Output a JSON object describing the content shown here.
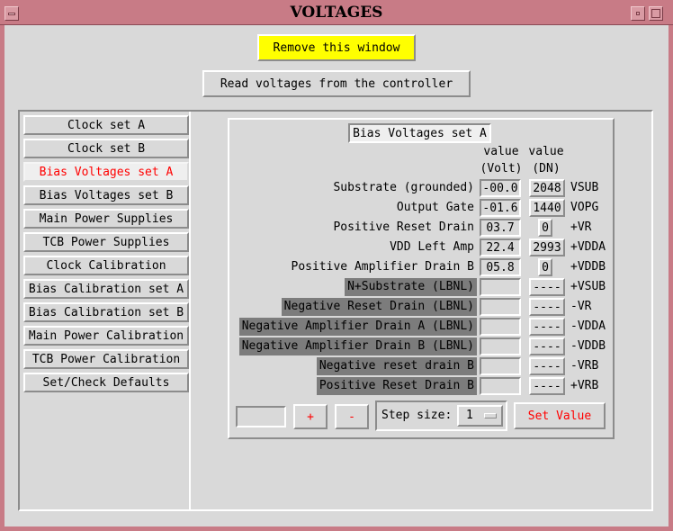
{
  "window": {
    "title": "VOLTAGES"
  },
  "buttons": {
    "remove_window": "Remove this window",
    "read_voltages": "Read voltages from the controller"
  },
  "nav": {
    "selected_index": 2,
    "items": [
      {
        "label": "Clock set A"
      },
      {
        "label": "Clock set B"
      },
      {
        "label": "Bias Voltages set A"
      },
      {
        "label": "Bias Voltages set B"
      },
      {
        "label": "Main Power Supplies"
      },
      {
        "label": "TCB Power Supplies"
      },
      {
        "label": "Clock Calibration"
      },
      {
        "label": "Bias Calibration set A"
      },
      {
        "label": "Bias Calibration set B"
      },
      {
        "label": "Main Power Calibration"
      },
      {
        "label": "TCB Power Calibration"
      },
      {
        "label": "Set/Check Defaults"
      }
    ]
  },
  "panel": {
    "header": "Bias Voltages set A",
    "col_value_volt": [
      "value",
      "(Volt)"
    ],
    "col_value_dn": [
      "value",
      "(DN)"
    ],
    "rows": [
      {
        "label": "Substrate  (grounded)",
        "volt": "-00.0",
        "dn": "2048",
        "signal": "VSUB",
        "dark": false
      },
      {
        "label": "Output Gate",
        "volt": "-01.6",
        "dn": "1440",
        "signal": "VOPG",
        "dark": false
      },
      {
        "label": "Positive Reset Drain",
        "volt": "03.7",
        "dn": "0",
        "signal": "+VR",
        "dark": false
      },
      {
        "label": "VDD Left Amp",
        "volt": "22.4",
        "dn": "2993",
        "signal": "+VDDA",
        "dark": false
      },
      {
        "label": "Positive Amplifier Drain B",
        "volt": "05.8",
        "dn": "0",
        "signal": "+VDDB",
        "dark": false
      },
      {
        "label": "N+Substrate (LBNL)",
        "volt": "",
        "dn": "----",
        "signal": "+VSUB",
        "dark": true
      },
      {
        "label": "Negative Reset Drain (LBNL)",
        "volt": "",
        "dn": "----",
        "signal": "-VR",
        "dark": true
      },
      {
        "label": "Negative Amplifier Drain A (LBNL)",
        "volt": "",
        "dn": "----",
        "signal": "-VDDA",
        "dark": true
      },
      {
        "label": "Negative Amplifier Drain B (LBNL)",
        "volt": "",
        "dn": "----",
        "signal": "-VDDB",
        "dark": true
      },
      {
        "label": "Negative reset drain B",
        "volt": "",
        "dn": "----",
        "signal": "-VRB",
        "dark": true
      },
      {
        "label": "Positive Reset Drain B",
        "volt": "",
        "dn": "----",
        "signal": "+VRB",
        "dark": true
      }
    ],
    "controls": {
      "entry_value": "",
      "plus_label": "+",
      "minus_label": "-",
      "step_label": "Step size:",
      "step_value": "1",
      "set_value_label": "Set Value"
    }
  }
}
